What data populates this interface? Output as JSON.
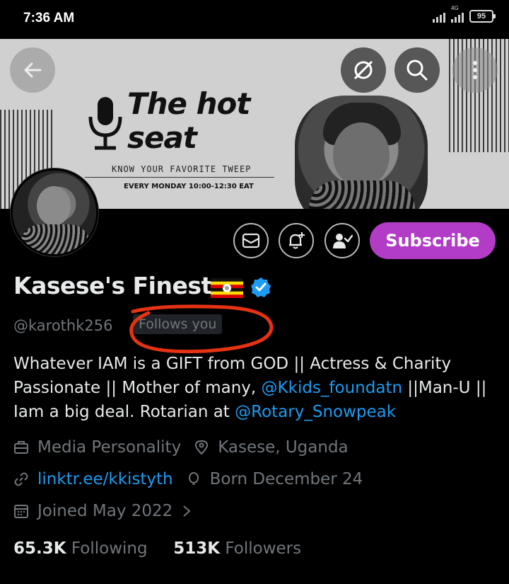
{
  "status_bar": {
    "time": "7:36 AM",
    "network_label": "4G",
    "battery": "95"
  },
  "banner": {
    "title_line1": "The hot",
    "title_line2": "seat",
    "subtitle": "KNOW YOUR FAVORITE TWEEP",
    "schedule": "EVERY MONDAY 10:00-12:30 EAT"
  },
  "header_actions": {
    "back_icon": "arrow-left-icon",
    "grok_icon": "grok-icon",
    "search_icon": "search-icon",
    "more_icon": "more-vertical-icon"
  },
  "profile_actions": {
    "message_icon": "envelope-icon",
    "notify_icon": "bell-plus-icon",
    "following_icon": "person-check-icon",
    "subscribe_label": "Subscribe",
    "subscribe_color": "#b23cc6"
  },
  "profile": {
    "name": "Kasese's Finest",
    "handle": "@karothk256",
    "follows_you": "Follows you",
    "bio_part1": "Whatever IAM is a GIFT from GOD || Actress & Charity Passionate || Mother of many, ",
    "bio_mention1": "@Kkids_foundatn",
    "bio_part2": " ||Man-U || Iam a big deal. Rotarian at ",
    "bio_mention2": "@Rotary_Snowpeak",
    "category": "Media Personality",
    "location": "Kasese, Uganda",
    "website": "linktr.ee/kkistyth",
    "birthday": "Born December 24",
    "joined": "Joined May 2022",
    "following_count": "65.3K",
    "following_label": "Following",
    "followers_count": "513K",
    "followers_label": "Followers"
  },
  "colors": {
    "link": "#1d9bf0",
    "annotation": "#e53212"
  }
}
